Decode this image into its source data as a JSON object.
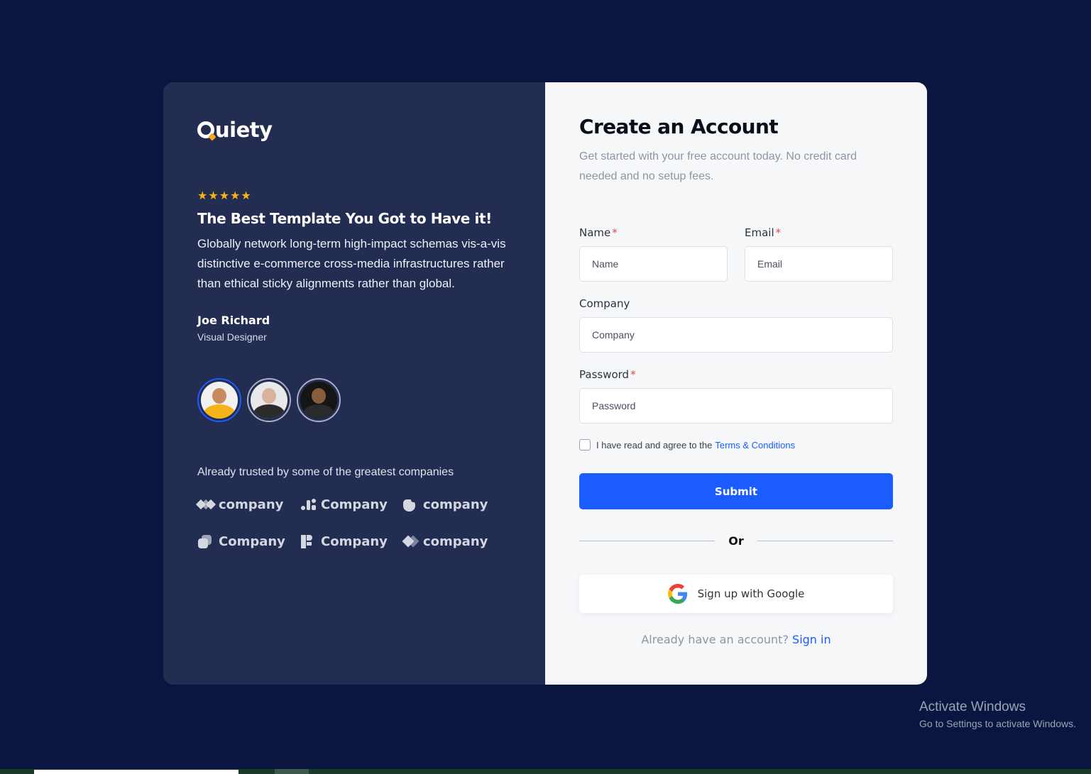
{
  "brand": {
    "name": "uiety"
  },
  "testimonial": {
    "stars": "★★★★★",
    "title": "The Best Template You Got to Have it!",
    "text": "Globally network long-term high-impact schemas vis-a-vis distinctive e-commerce cross-media infrastructures rather than ethical sticky alignments rather than global.",
    "author_name": "Joe Richard",
    "author_role": "Visual Designer"
  },
  "trusted": {
    "text": "Already trusted by some of the greatest companies",
    "companies": [
      {
        "label": "company",
        "icon": "diamond-link-icon"
      },
      {
        "label": "Company",
        "icon": "dots-bars-icon"
      },
      {
        "label": "company",
        "icon": "rounded-blob-icon"
      },
      {
        "label": "Company",
        "icon": "stacked-square-icon"
      },
      {
        "label": "Company",
        "icon": "block-f-icon"
      },
      {
        "label": "company",
        "icon": "arrow-diamond-icon"
      }
    ]
  },
  "form": {
    "title": "Create an Account",
    "subtitle": "Get started with your free account today. No credit card needed and no setup fees.",
    "name_label": "Name",
    "name_placeholder": "Name",
    "email_label": "Email",
    "email_placeholder": "Email",
    "company_label": "Company",
    "company_placeholder": "Company",
    "password_label": "Password",
    "password_placeholder": "Password",
    "required_mark": "*",
    "agree_text": "I have read and agree to the",
    "terms_link": "Terms & Conditions",
    "submit_label": "Submit",
    "or_label": "Or",
    "google_label": "Sign up with Google",
    "have_account": "Already have an account?",
    "signin_link": "Sign in"
  },
  "watermark": {
    "line1": "Activate Windows",
    "line2": "Go to Settings to activate Windows."
  },
  "colors": {
    "page_bg": "#0b1640",
    "left_panel": "#232d52",
    "accent": "#1a5cff",
    "stars": "#f5b50a"
  }
}
